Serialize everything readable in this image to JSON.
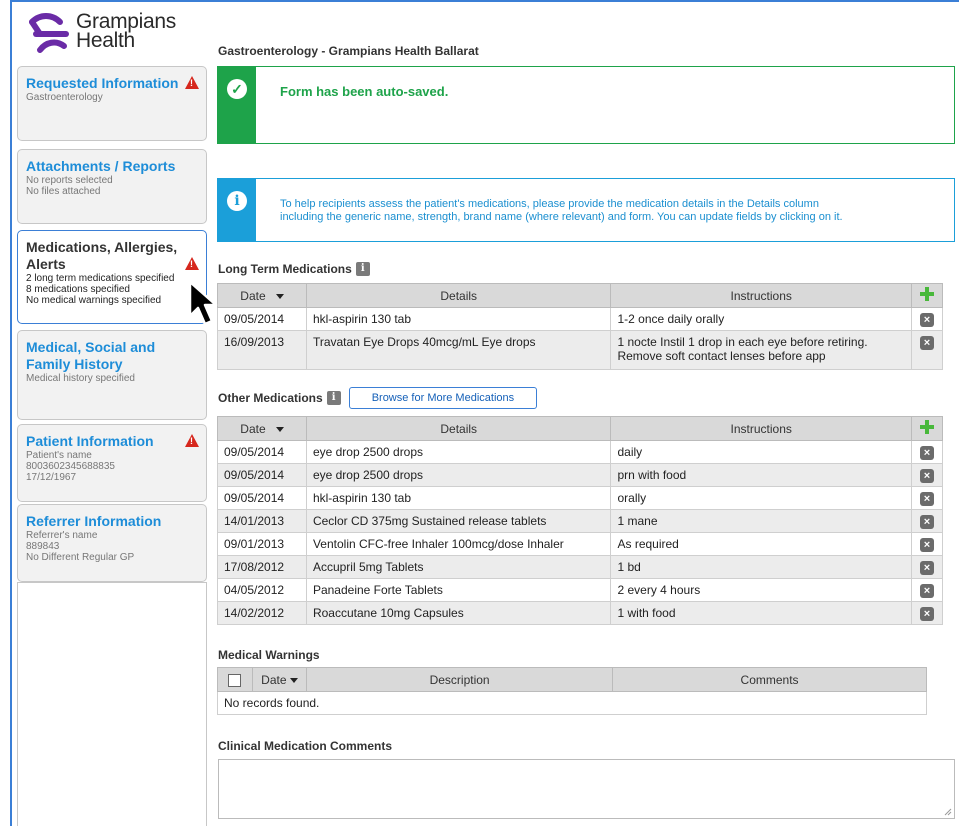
{
  "brand": {
    "line1": "Grampians",
    "line2": "Health"
  },
  "header": {
    "title": "Gastroenterology - Grampians Health Ballarat"
  },
  "sidebar": {
    "items": [
      {
        "title": "Requested Information",
        "subs": [
          "Gastroenterology"
        ],
        "warning": true
      },
      {
        "title": "Attachments / Reports",
        "subs": [
          "No reports selected",
          "No files attached"
        ],
        "warning": false
      },
      {
        "title": "Medications, Allergies, Alerts",
        "subs": [
          "2 long term medications specified",
          "8 medications specified",
          "No medical warnings specified"
        ],
        "warning": true,
        "active": true
      },
      {
        "title": "Medical, Social and Family History",
        "subs": [
          "Medical history specified"
        ],
        "warning": false
      },
      {
        "title": "Patient Information",
        "subs": [
          "Patient's name",
          "8003602345688835",
          "17/12/1967"
        ],
        "warning": true
      },
      {
        "title": "Referrer Information",
        "subs": [
          "Referrer's name",
          "889843",
          "No Different Regular GP"
        ],
        "warning": false
      }
    ]
  },
  "autosave": {
    "message": "Form has been auto-saved.",
    "color": "#1ea34a"
  },
  "infobanner": {
    "line1": "To help recipients assess the patient's medications, please provide the medication details in the Details column",
    "line2": "including the generic name, strength, brand name (where relevant) and form. You can update fields by clicking on it.",
    "color": "#1b9fd9"
  },
  "long_term": {
    "label": "Long Term Medications",
    "columns": {
      "date": "Date",
      "details": "Details",
      "instructions": "Instructions"
    },
    "rows": [
      {
        "date": "09/05/2014",
        "details": "hkl-aspirin 130 tab",
        "instructions": "1-2 once daily orally"
      },
      {
        "date": "16/09/2013",
        "details": "Travatan Eye Drops 40mcg/mL Eye drops",
        "instructions": "1 nocte Instil 1 drop in each eye before retiring.",
        "instructions2": "Remove soft contact lenses before app"
      }
    ]
  },
  "other": {
    "label": "Other Medications",
    "browse_label": "Browse for More Medications",
    "columns": {
      "date": "Date",
      "details": "Details",
      "instructions": "Instructions"
    },
    "rows": [
      {
        "date": "09/05/2014",
        "details": "eye drop 2500 drops",
        "instructions": "daily"
      },
      {
        "date": "09/05/2014",
        "details": "eye drop 2500 drops",
        "instructions": "prn with food"
      },
      {
        "date": "09/05/2014",
        "details": "hkl-aspirin 130 tab",
        "instructions": "orally"
      },
      {
        "date": "14/01/2013",
        "details": "Ceclor CD 375mg Sustained release tablets",
        "instructions": "1 mane"
      },
      {
        "date": "09/01/2013",
        "details": "Ventolin CFC-free Inhaler 100mcg/dose Inhaler",
        "instructions": "As required"
      },
      {
        "date": "17/08/2012",
        "details": "Accupril 5mg Tablets",
        "instructions": "1 bd"
      },
      {
        "date": "04/05/2012",
        "details": "Panadeine Forte Tablets",
        "instructions": "2 every 4 hours"
      },
      {
        "date": "14/02/2012",
        "details": "Roaccutane 10mg Capsules",
        "instructions": "1 with food"
      }
    ]
  },
  "warnings": {
    "label": "Medical Warnings",
    "columns": {
      "date": "Date",
      "description": "Description",
      "comments": "Comments"
    },
    "empty": "No records found."
  },
  "comments": {
    "label": "Clinical Medication Comments"
  }
}
